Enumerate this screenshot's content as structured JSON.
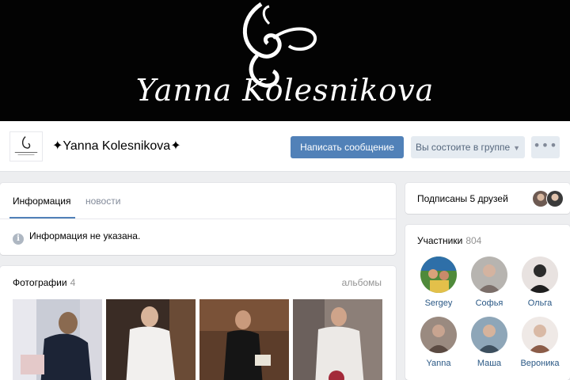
{
  "cover": {
    "text": "Yanna Kolesnikova"
  },
  "header": {
    "title": "✦Yanna Kolesnikova✦",
    "message_button": "Написать сообщение",
    "member_button": "Вы состоите в группе",
    "more_button": "•••"
  },
  "info": {
    "tabs": [
      {
        "label": "Информация"
      },
      {
        "label": "новости"
      }
    ],
    "empty_text": "Информация не указана."
  },
  "photos": {
    "title": "Фотографии",
    "count": "4",
    "albums_label": "альбомы"
  },
  "friends": {
    "text": "Подписаны 5 друзей"
  },
  "members": {
    "title": "Участники",
    "count": "804",
    "list": [
      {
        "name": "Sergey"
      },
      {
        "name": "Софья"
      },
      {
        "name": "Ольга"
      },
      {
        "name": "Yanna"
      },
      {
        "name": "Маша"
      },
      {
        "name": "Вероника"
      }
    ]
  },
  "colors": {
    "accent": "#5181b8",
    "link": "#2a5885",
    "page_background": "#edeef0"
  },
  "icons": [
    "info-icon",
    "chevron-down-icon",
    "more-icon"
  ]
}
